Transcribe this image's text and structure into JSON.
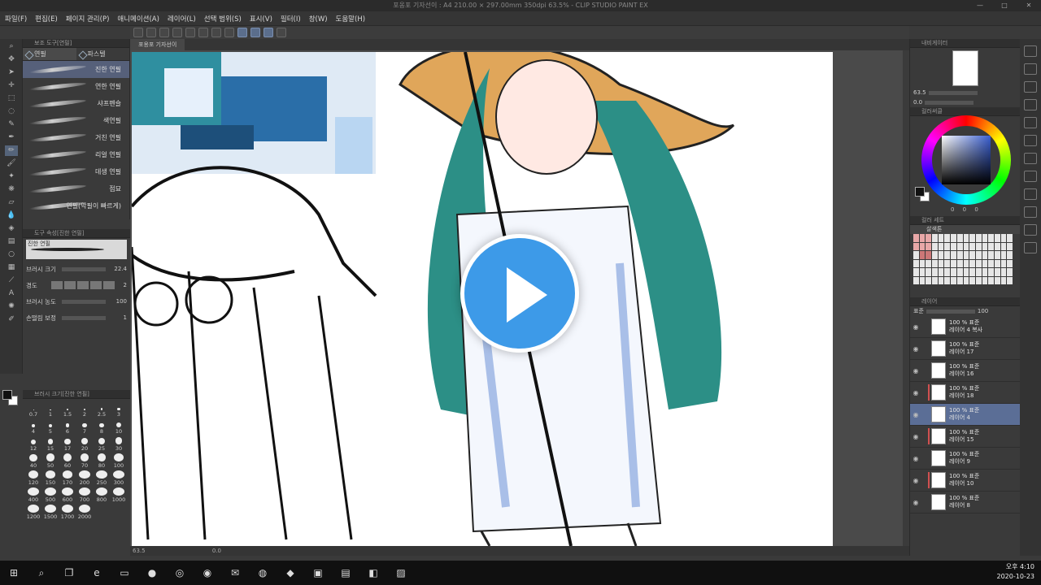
{
  "window": {
    "title": "포옹포 기자선이 : A4 210.00 × 297.00mm 350dpi 63.5% - CLIP STUDIO PAINT EX",
    "minimize": "—",
    "maximize": "□",
    "close": "✕"
  },
  "menu": [
    "파일(F)",
    "편집(E)",
    "페이지 관리(P)",
    "애니메이션(A)",
    "레이어(L)",
    "선택 범위(S)",
    "표시(V)",
    "필터(I)",
    "창(W)",
    "도움말(H)"
  ],
  "subtool": {
    "title": "보조 도구[연필]",
    "tabs": [
      "연필",
      "파스텔"
    ],
    "brushes": [
      "진한 연필",
      "연한 연필",
      "샤프펜슬",
      "색연필",
      "거친 연필",
      "리얼 연필",
      "데생 연필",
      "점묘",
      "연필(악필이 빠르게)"
    ]
  },
  "tool_property": {
    "title": "도구 속성[진한 연필]",
    "brush_name": "진한 연필",
    "rows": [
      {
        "label": "브러시 크기",
        "value": "22.4"
      },
      {
        "label": "경도",
        "value": "2"
      },
      {
        "label": "브러시 농도",
        "value": "100"
      },
      {
        "label": "손떨림 보정",
        "value": "1"
      }
    ]
  },
  "brush_size": {
    "title": "브러시 크기[진한 연필]",
    "sizes": [
      "0.7",
      "1",
      "1.5",
      "2",
      "2.5",
      "3",
      "4",
      "5",
      "6",
      "7",
      "8",
      "10",
      "12",
      "15",
      "17",
      "20",
      "25",
      "30",
      "40",
      "50",
      "60",
      "70",
      "80",
      "100",
      "120",
      "150",
      "170",
      "200",
      "250",
      "300",
      "400",
      "500",
      "600",
      "700",
      "800",
      "1000",
      "1200",
      "1500",
      "1700",
      "2000"
    ]
  },
  "canvas": {
    "tab": "포옹포 기자선이",
    "zoom": "63.5",
    "angle": "0.0"
  },
  "navigator": {
    "title": "내비게이터",
    "zoom": "63.5",
    "angle": "0.0"
  },
  "color_wheel": {
    "title": "컬러써클",
    "values": "0 0 0"
  },
  "color_set": {
    "title": "컬러 세트",
    "name": "살색톤"
  },
  "layer_panel": {
    "title": "레이어",
    "blend": "표준",
    "opacity": "100",
    "layers": [
      {
        "mode": "100 % 표준",
        "name": "레이어 4 복사",
        "selected": false,
        "marked": false
      },
      {
        "mode": "100 % 표준",
        "name": "레이어 17",
        "selected": false,
        "marked": false
      },
      {
        "mode": "100 % 표준",
        "name": "레이어 16",
        "selected": false,
        "marked": false
      },
      {
        "mode": "100 % 표준",
        "name": "레이어 18",
        "selected": false,
        "marked": true
      },
      {
        "mode": "100 % 표준",
        "name": "레이어 4",
        "selected": true,
        "marked": false
      },
      {
        "mode": "100 % 표준",
        "name": "레이어 15",
        "selected": false,
        "marked": true
      },
      {
        "mode": "100 % 표준",
        "name": "레이어 9",
        "selected": false,
        "marked": false
      },
      {
        "mode": "100 % 표준",
        "name": "레이어 10",
        "selected": false,
        "marked": true
      },
      {
        "mode": "100 % 표준",
        "name": "레이어 8",
        "selected": false,
        "marked": false
      }
    ]
  },
  "taskbar": {
    "time": "오후 4:10",
    "date": "2020-10-23"
  },
  "colors": {
    "accent": "#3d9ae8",
    "selection": "#5b6e96"
  }
}
